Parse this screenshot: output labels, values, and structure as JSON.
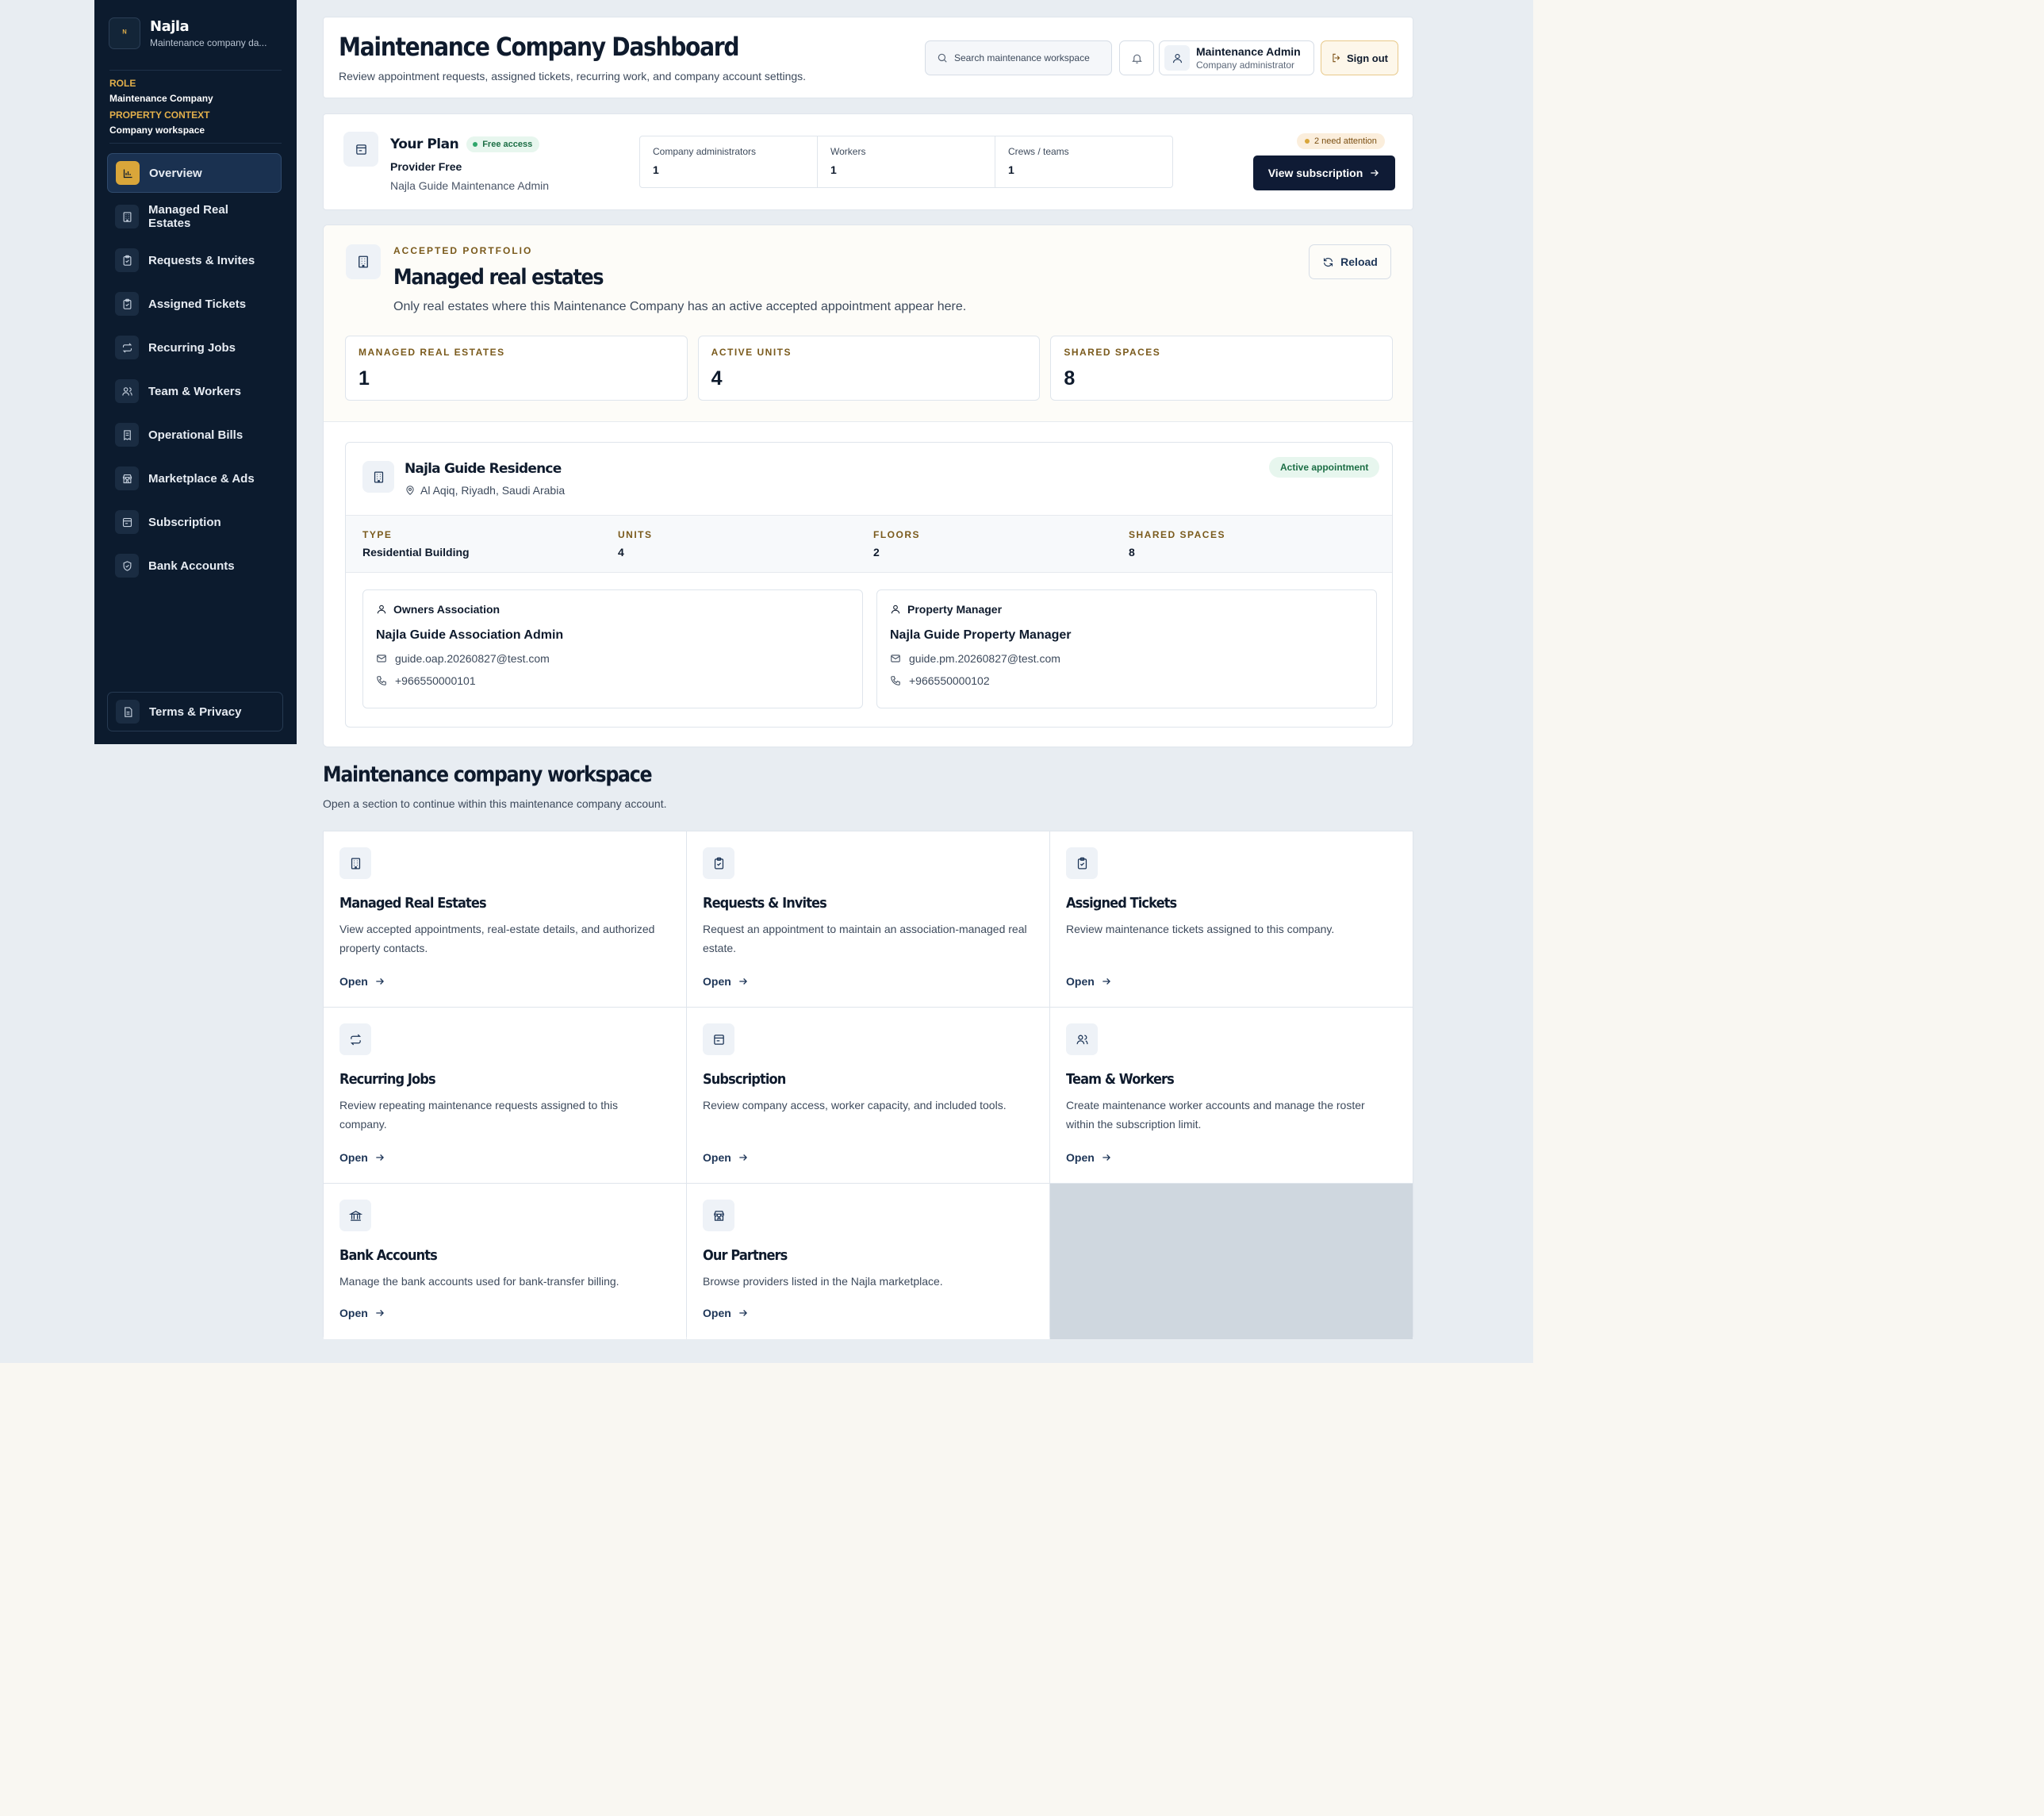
{
  "brand": {
    "logo_text": "ᴺ",
    "name": "Najla",
    "subtitle": "Maintenance company da..."
  },
  "context": {
    "role_label": "ROLE",
    "role_value": "Maintenance Company",
    "property_label": "PROPERTY CONTEXT",
    "property_value": "Company workspace"
  },
  "sidebar": {
    "items": [
      {
        "label": "Overview",
        "icon": "chart-icon"
      },
      {
        "label": "Managed Real Estates",
        "icon": "building-icon"
      },
      {
        "label": "Requests & Invites",
        "icon": "clipboard-check-icon"
      },
      {
        "label": "Assigned Tickets",
        "icon": "clipboard-check-icon"
      },
      {
        "label": "Recurring Jobs",
        "icon": "repeat-icon"
      },
      {
        "label": "Team & Workers",
        "icon": "users-icon"
      },
      {
        "label": "Operational Bills",
        "icon": "receipt-icon"
      },
      {
        "label": "Marketplace & Ads",
        "icon": "store-icon"
      },
      {
        "label": "Subscription",
        "icon": "credit-card-icon"
      },
      {
        "label": "Bank Accounts",
        "icon": "shield-icon"
      }
    ],
    "terms": "Terms & Privacy"
  },
  "header": {
    "title": "Maintenance Company Dashboard",
    "subtitle": "Review appointment requests, assigned tickets, recurring work, and company account settings.",
    "search_placeholder": "Search maintenance workspace",
    "user_name": "Maintenance Admin",
    "user_role": "Company administrator",
    "sign_out": "Sign out"
  },
  "plan": {
    "title": "Your Plan",
    "badge": "Free access",
    "name": "Provider Free",
    "owner": "Najla Guide Maintenance Admin",
    "stats": [
      {
        "label": "Company administrators",
        "value": "1"
      },
      {
        "label": "Workers",
        "value": "1"
      },
      {
        "label": "Crews / teams",
        "value": "1"
      }
    ],
    "attention": "2 need attention",
    "cta": "View subscription"
  },
  "portfolio": {
    "eyebrow": "ACCEPTED PORTFOLIO",
    "title": "Managed real estates",
    "description": "Only real estates where this Maintenance Company has an active accepted appointment appear here.",
    "reload": "Reload",
    "stats": [
      {
        "label": "MANAGED REAL ESTATES",
        "value": "1"
      },
      {
        "label": "ACTIVE UNITS",
        "value": "4"
      },
      {
        "label": "SHARED SPACES",
        "value": "8"
      }
    ],
    "estate": {
      "name": "Najla Guide Residence",
      "location": "Al Aqiq, Riyadh, Saudi Arabia",
      "status": "Active appointment",
      "facts": [
        {
          "label": "TYPE",
          "value": "Residential Building"
        },
        {
          "label": "UNITS",
          "value": "4"
        },
        {
          "label": "FLOORS",
          "value": "2"
        },
        {
          "label": "SHARED SPACES",
          "value": "8"
        }
      ],
      "contacts": [
        {
          "role": "Owners Association",
          "name": "Najla Guide Association Admin",
          "email": "guide.oap.20260827@test.com",
          "phone": "+966550000101"
        },
        {
          "role": "Property Manager",
          "name": "Najla Guide Property Manager",
          "email": "guide.pm.20260827@test.com",
          "phone": "+966550000102"
        }
      ]
    }
  },
  "workspace": {
    "title": "Maintenance company workspace",
    "subtitle": "Open a section to continue within this maintenance company account.",
    "open_label": "Open",
    "cards": [
      {
        "name": "Managed Real Estates",
        "icon": "building-icon",
        "desc": "View accepted appointments, real-estate details, and authorized property contacts."
      },
      {
        "name": "Requests & Invites",
        "icon": "clipboard-check-icon",
        "desc": "Request an appointment to maintain an association-managed real estate."
      },
      {
        "name": "Assigned Tickets",
        "icon": "clipboard-check-icon",
        "desc": "Review maintenance tickets assigned to this company."
      },
      {
        "name": "Recurring Jobs",
        "icon": "repeat-icon",
        "desc": "Review repeating maintenance requests assigned to this company."
      },
      {
        "name": "Subscription",
        "icon": "credit-card-icon",
        "desc": "Review company access, worker capacity, and included tools."
      },
      {
        "name": "Team & Workers",
        "icon": "users-icon",
        "desc": "Create maintenance worker accounts and manage the roster within the subscription limit."
      },
      {
        "name": "Bank Accounts",
        "icon": "bank-icon",
        "desc": "Manage the bank accounts used for bank-transfer billing."
      },
      {
        "name": "Our Partners",
        "icon": "store-icon",
        "desc": "Browse providers listed in the Najla marketplace."
      }
    ]
  },
  "colors": {
    "sidebar_bg": "#0c1b2e",
    "accent_gold": "#d9a63a",
    "primary_dark": "#0f1b35",
    "success_green": "#1c6e45"
  }
}
